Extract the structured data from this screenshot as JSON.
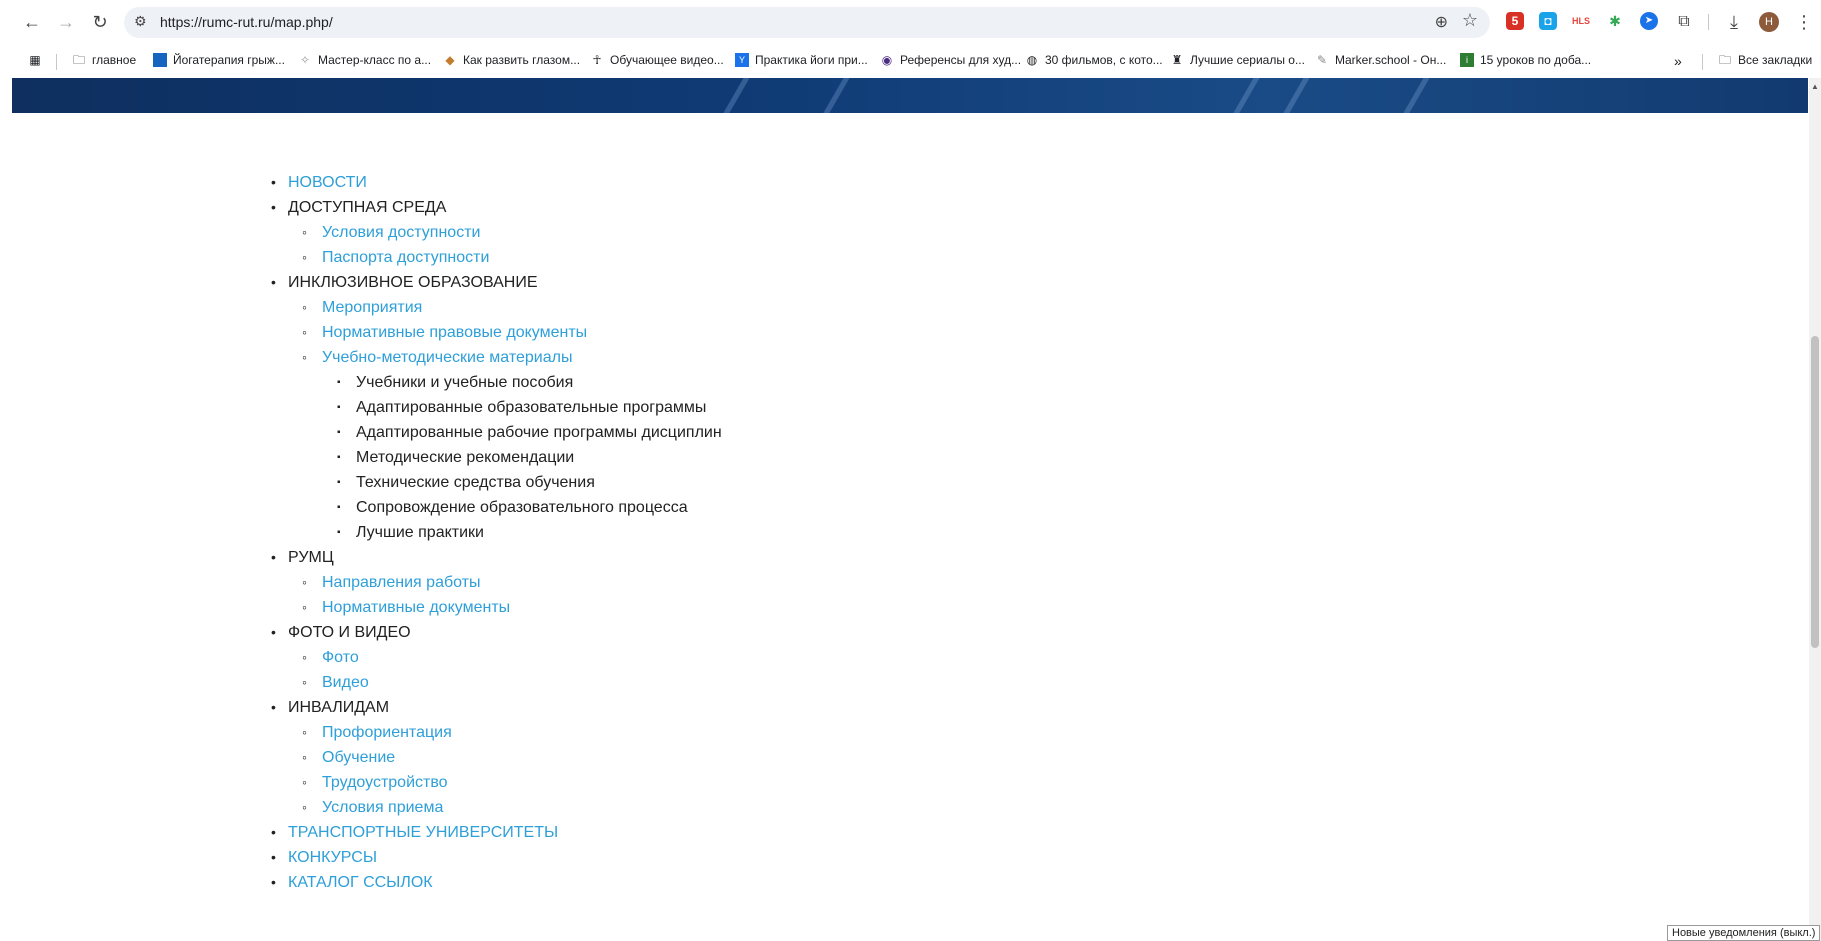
{
  "browser": {
    "url": "https://rumc-rut.ru/map.php/",
    "bookmarks": [
      {
        "label": "главное",
        "icon": "folder-icon"
      },
      {
        "label": "Йогатерапия грыж...",
        "icon": "bookmark-favicon"
      },
      {
        "label": "Мастер-класс по а...",
        "icon": "bookmark-favicon"
      },
      {
        "label": "Как развить глазом...",
        "icon": "bookmark-favicon"
      },
      {
        "label": "Обучающее видео...",
        "icon": "bookmark-favicon"
      },
      {
        "label": "Практика йоги при...",
        "icon": "bookmark-favicon"
      },
      {
        "label": "Референсы для худ...",
        "icon": "bookmark-favicon"
      },
      {
        "label": "30 фильмов, с кото...",
        "icon": "bookmark-favicon"
      },
      {
        "label": "Лучшие сериалы о...",
        "icon": "bookmark-favicon"
      },
      {
        "label": "Marker.school - Он...",
        "icon": "bookmark-favicon"
      },
      {
        "label": "15 уроков по доба...",
        "icon": "bookmark-favicon"
      }
    ],
    "overflow": "»",
    "all_bookmarks": "Все закладки",
    "avatar_letter": "Н",
    "extensions": [
      {
        "name": "extension-badge-icon",
        "label": "5",
        "color": "#d93025"
      },
      {
        "name": "extension-square-icon",
        "label": "◘",
        "color": "#1aa3e8"
      },
      {
        "name": "extension-hls-icon",
        "label": "HLS",
        "color": "#e8453c"
      },
      {
        "name": "extension-flower-icon",
        "label": "✱",
        "color": "#34a853"
      },
      {
        "name": "extension-telegram-icon",
        "label": "➤",
        "color": "#1a73e8"
      }
    ]
  },
  "sitemap": {
    "news": "НОВОСТИ",
    "accessible": {
      "title": "ДОСТУПНАЯ СРЕДА",
      "items": [
        "Условия доступности",
        "Паспорта доступности"
      ]
    },
    "inclusive": {
      "title": "ИНКЛЮЗИВНОЕ ОБРАЗОВАНИЕ",
      "items": [
        "Мероприятия",
        "Нормативные правовые документы",
        "Учебно-методические материалы"
      ],
      "subitems": [
        "Учебники и учебные пособия",
        "Адаптированные образовательные программы",
        "Адаптированные рабочие программы дисциплин",
        "Методические рекомендации",
        "Технические средства обучения",
        "Сопровождение образовательного процесса",
        "Лучшие практики"
      ]
    },
    "rumc": {
      "title": "РУМЦ",
      "items": [
        "Направления работы",
        "Нормативные документы"
      ]
    },
    "media": {
      "title": "ФОТО И ВИДЕО",
      "items": [
        "Фото",
        "Видео"
      ]
    },
    "disabled": {
      "title": "ИНВАЛИДАМ",
      "items": [
        "Профориентация",
        "Обучение",
        "Трудоустройство",
        "Условия приема"
      ]
    },
    "transport": "ТРАНСПОРТНЫЕ УНИВЕРСИТЕТЫ",
    "contests": "КОНКУРСЫ",
    "catalog": "КАТАЛОГ ССЫЛОК"
  },
  "notification": "Новые уведомления (выкл.)",
  "colors": {
    "link": "#2e9fd8",
    "banner": "#0f3a74"
  }
}
